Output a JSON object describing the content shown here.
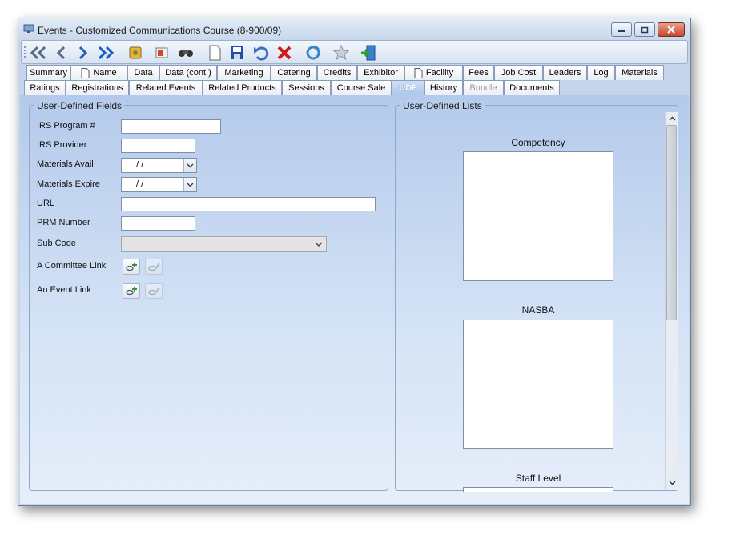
{
  "window": {
    "title": "Events - Customized Communications Course  (8-900/09)"
  },
  "tabs_row1": [
    {
      "label": "Summary"
    },
    {
      "label": "Name",
      "doc": true
    },
    {
      "label": "Data"
    },
    {
      "label": "Data (cont.)"
    },
    {
      "label": "Marketing"
    },
    {
      "label": "Catering"
    },
    {
      "label": "Credits"
    },
    {
      "label": "Exhibitor"
    },
    {
      "label": "Facility",
      "doc": true
    },
    {
      "label": "Fees"
    },
    {
      "label": "Job Cost"
    },
    {
      "label": "Leaders"
    },
    {
      "label": "Log"
    },
    {
      "label": "Materials"
    }
  ],
  "tabs_row2": [
    {
      "label": "Ratings"
    },
    {
      "label": "Registrations"
    },
    {
      "label": "Related Events"
    },
    {
      "label": "Related Products"
    },
    {
      "label": "Sessions"
    },
    {
      "label": "Course Sale"
    },
    {
      "label": "UDF",
      "active": true
    },
    {
      "label": "History"
    },
    {
      "label": "Bundle",
      "disabled": true
    },
    {
      "label": "Documents"
    }
  ],
  "udf": {
    "legend": "User-Defined Fields",
    "irs_program_label": "IRS Program #",
    "irs_provider_label": "IRS Provider",
    "materials_avail_label": "Materials Avail",
    "materials_expire_label": "Materials Expire",
    "date_placeholder": "  /     /",
    "url_label": "URL",
    "prm_label": "PRM Number",
    "sub_code_label": "Sub Code",
    "committee_link_label": "A Committee Link",
    "event_link_label": "An Event Link",
    "irs_program_value": "",
    "irs_provider_value": "",
    "url_value": "",
    "prm_value": ""
  },
  "lists": {
    "legend": "User-Defined Lists",
    "competency": "Competency",
    "nasba": "NASBA",
    "staff_level": "Staff Level"
  }
}
